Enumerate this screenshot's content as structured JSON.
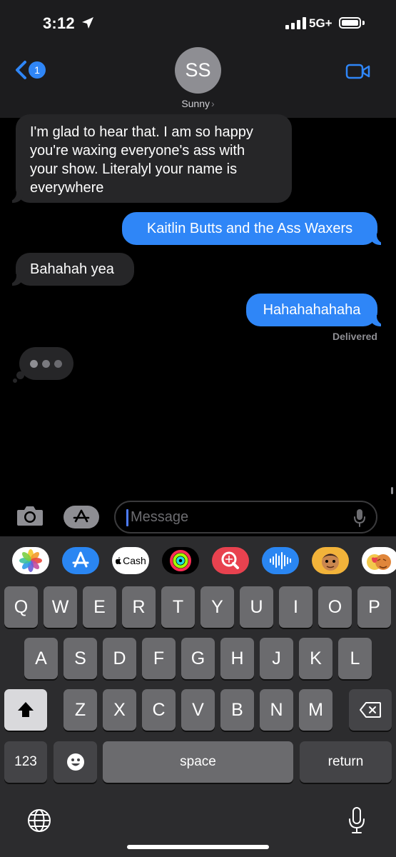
{
  "status_bar": {
    "time": "3:12",
    "network": "5G+",
    "icons": [
      "location-arrow-icon",
      "signal-icon",
      "battery-icon"
    ]
  },
  "header": {
    "back_badge": "1",
    "avatar_initials": "SS",
    "contact_name": "Sunny",
    "chevron": "›",
    "icons": [
      "back-chevron-icon",
      "video-call-icon"
    ]
  },
  "conversation": {
    "messages": [
      {
        "direction": "incoming",
        "lines": [
          "I'm glad to hear that. I am so happy",
          "you're waxing everyone's ass with",
          "your show. Literalyl your name is",
          "everywhere"
        ]
      },
      {
        "direction": "outgoing",
        "text": "Kaitlin Butts and the Ass Waxers"
      },
      {
        "direction": "incoming",
        "text": "Bahahah yea"
      },
      {
        "direction": "outgoing",
        "text": "Hahahahahaha"
      }
    ],
    "status": "Delivered"
  },
  "composer": {
    "placeholder": "Message",
    "icons": [
      "camera-icon",
      "app-store-icon",
      "microphone-icon"
    ]
  },
  "app_strip": {
    "items": [
      {
        "name": "photos-app",
        "icon": "photos-icon"
      },
      {
        "name": "app-store-app",
        "icon": "app-store-icon"
      },
      {
        "name": "apple-cash-app",
        "label": "Cash",
        "icon": "apple-logo-icon"
      },
      {
        "name": "activity-app",
        "icon": "activity-rings-icon"
      },
      {
        "name": "images-search-app",
        "icon": "image-search-icon"
      },
      {
        "name": "audio-message-app",
        "icon": "audio-waveform-icon"
      },
      {
        "name": "memoji-app",
        "icon": "memoji-icon"
      },
      {
        "name": "memoji-stickers-app",
        "icon": "memoji-stickers-icon"
      }
    ]
  },
  "keyboard": {
    "row1": [
      "Q",
      "W",
      "E",
      "R",
      "T",
      "Y",
      "U",
      "I",
      "O",
      "P"
    ],
    "row2": [
      "A",
      "S",
      "D",
      "F",
      "G",
      "H",
      "J",
      "K",
      "L"
    ],
    "row3": [
      "Z",
      "X",
      "C",
      "V",
      "B",
      "N",
      "M"
    ],
    "numbers_key": "123",
    "space_key": "space",
    "return_key": "return",
    "icons": [
      "shift-icon",
      "delete-icon",
      "emoji-icon",
      "globe-icon",
      "dictation-mic-icon"
    ]
  },
  "colors": {
    "accent": "#2f86f7",
    "incoming_bubble": "#262628",
    "keyboard_bg": "#2c2c2e",
    "key": "#6b6b6e"
  }
}
